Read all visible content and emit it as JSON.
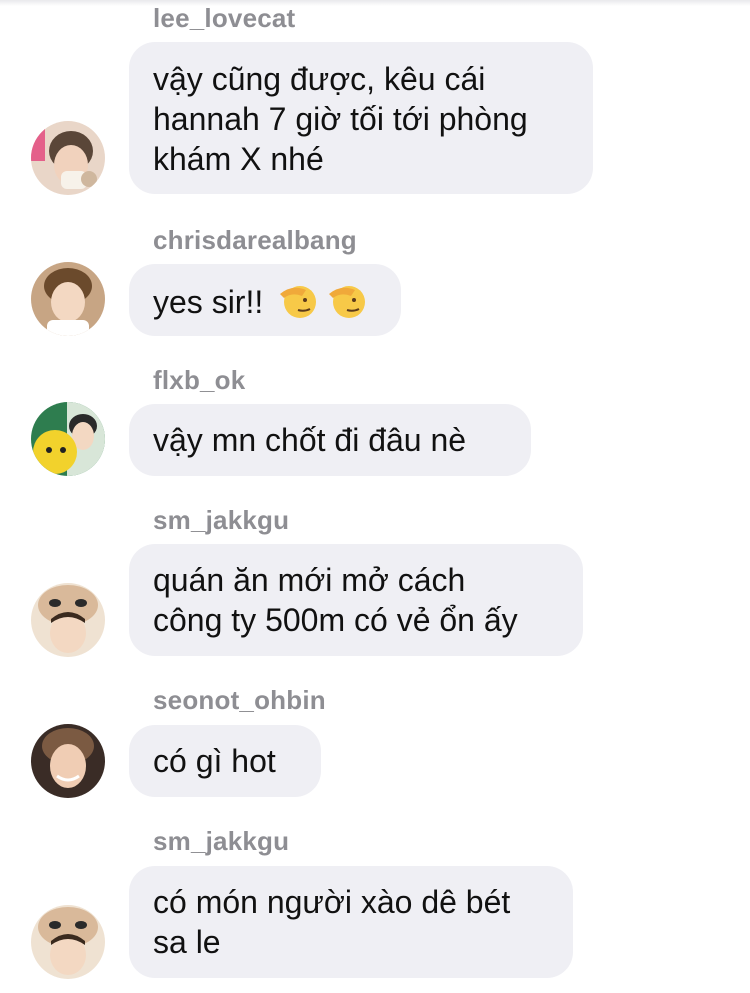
{
  "messages": [
    {
      "username": "lee_lovecat",
      "text": "vậy cũng được, kêu cái\nhannah 7 giờ tối tới phòng\nkhám X nhé",
      "avatar": "avatar-lee-lovecat"
    },
    {
      "username": "chrisdarealbang",
      "text": "yes sir!!",
      "emoji": [
        "saluting-face-emoji",
        "saluting-face-emoji"
      ],
      "avatar": "avatar-chrisdarealbang"
    },
    {
      "username": "flxb_ok",
      "text": "vậy mn chốt đi đâu nè",
      "avatar": "avatar-flxb-ok"
    },
    {
      "username": "sm_jakkgu",
      "text": "quán ăn mới mở cách\ncông ty 500m có vẻ ổn ấy",
      "avatar": "avatar-sm-jakkgu"
    },
    {
      "username": "seonot_ohbin",
      "text": "có gì hot",
      "avatar": "avatar-seonot-ohbin"
    },
    {
      "username": "sm_jakkgu",
      "text": "có món người xào dê bét\nsa le",
      "avatar": "avatar-sm-jakkgu"
    }
  ],
  "colors": {
    "bubble": "#efeff4",
    "username": "#8e8e93",
    "text": "#111111"
  }
}
